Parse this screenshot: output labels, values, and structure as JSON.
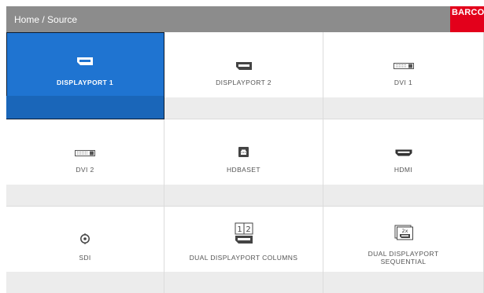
{
  "header": {
    "breadcrumb": "Home / Source",
    "logo_text": "BARCO",
    "background": "#8c8c8c",
    "logo_color": "#e3001b"
  },
  "sources": [
    {
      "label": "DISPLAYPORT 1",
      "icon": "displayport-icon",
      "selected": true
    },
    {
      "label": "DISPLAYPORT 2",
      "icon": "displayport-icon",
      "selected": false
    },
    {
      "label": "DVI 1",
      "icon": "dvi-icon",
      "selected": false
    },
    {
      "label": "DVI 2",
      "icon": "dvi-icon",
      "selected": false
    },
    {
      "label": "HDBASET",
      "icon": "hdbaset-icon",
      "selected": false
    },
    {
      "label": "HDMI",
      "icon": "hdmi-icon",
      "selected": false
    },
    {
      "label": "SDI",
      "icon": "sdi-icon",
      "selected": false
    },
    {
      "label": "DUAL DISPLAYPORT COLUMNS",
      "icon": "dual-displayport-columns-icon",
      "selected": false
    },
    {
      "label": "DUAL DISPLAYPORT SEQUENTIAL",
      "icon": "dual-displayport-sequential-icon",
      "selected": false
    }
  ],
  "colors": {
    "selected": "#1f74d1",
    "tile_footer": "#ececec"
  }
}
